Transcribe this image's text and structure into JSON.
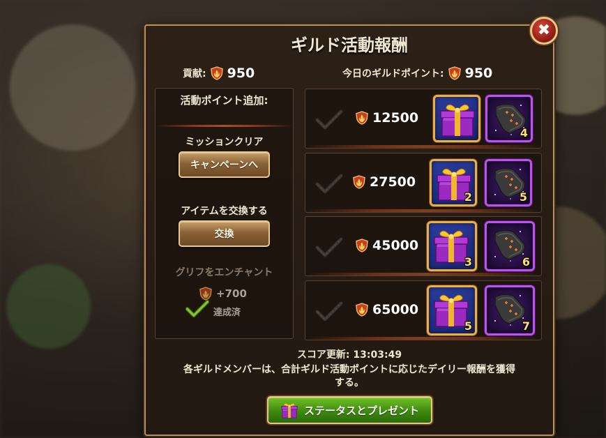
{
  "title": "ギルド活動報酬",
  "close_label": "✖",
  "contribution": {
    "label": "貢献:",
    "value": "950"
  },
  "today_points": {
    "label": "今日のギルドポイント:",
    "value": "950"
  },
  "left": {
    "header": "活動ポイント追加:",
    "mission_label": "ミッションクリア",
    "campaign_button": "キャンペーンへ",
    "exchange_label": "アイテムを交換する",
    "exchange_button": "交換",
    "enchant_label": "グリフをエンチャント",
    "enchant_bonus": "+700",
    "enchant_status": "達成済"
  },
  "tiers": [
    {
      "points": "12500",
      "gift_qty": "",
      "glyph_qty": "4"
    },
    {
      "points": "27500",
      "gift_qty": "2",
      "glyph_qty": "5"
    },
    {
      "points": "45000",
      "gift_qty": "3",
      "glyph_qty": "6"
    },
    {
      "points": "65000",
      "gift_qty": "5",
      "glyph_qty": "7"
    }
  ],
  "footer": {
    "score_update": "スコア更新: 13:03:49",
    "description_line1": "各ギルドメンバーは、合計ギルド活動ポイントに応じたデイリー報酬を獲得",
    "description_line2": "する。",
    "status_button": "ステータスとプレゼント"
  },
  "icons": {
    "points": "shield-flame-icon",
    "gift": "gift-box-icon",
    "glyph": "glyph-rune-icon",
    "check": "check-icon",
    "close": "close-icon"
  },
  "colors": {
    "panel_border": "#b8925a",
    "gold_button": "#8a6238",
    "green_button": "#3e8a10",
    "glyph_frame": "#c050f0",
    "gift_frame": "#e8b048",
    "qty_text": "#ffe070"
  }
}
